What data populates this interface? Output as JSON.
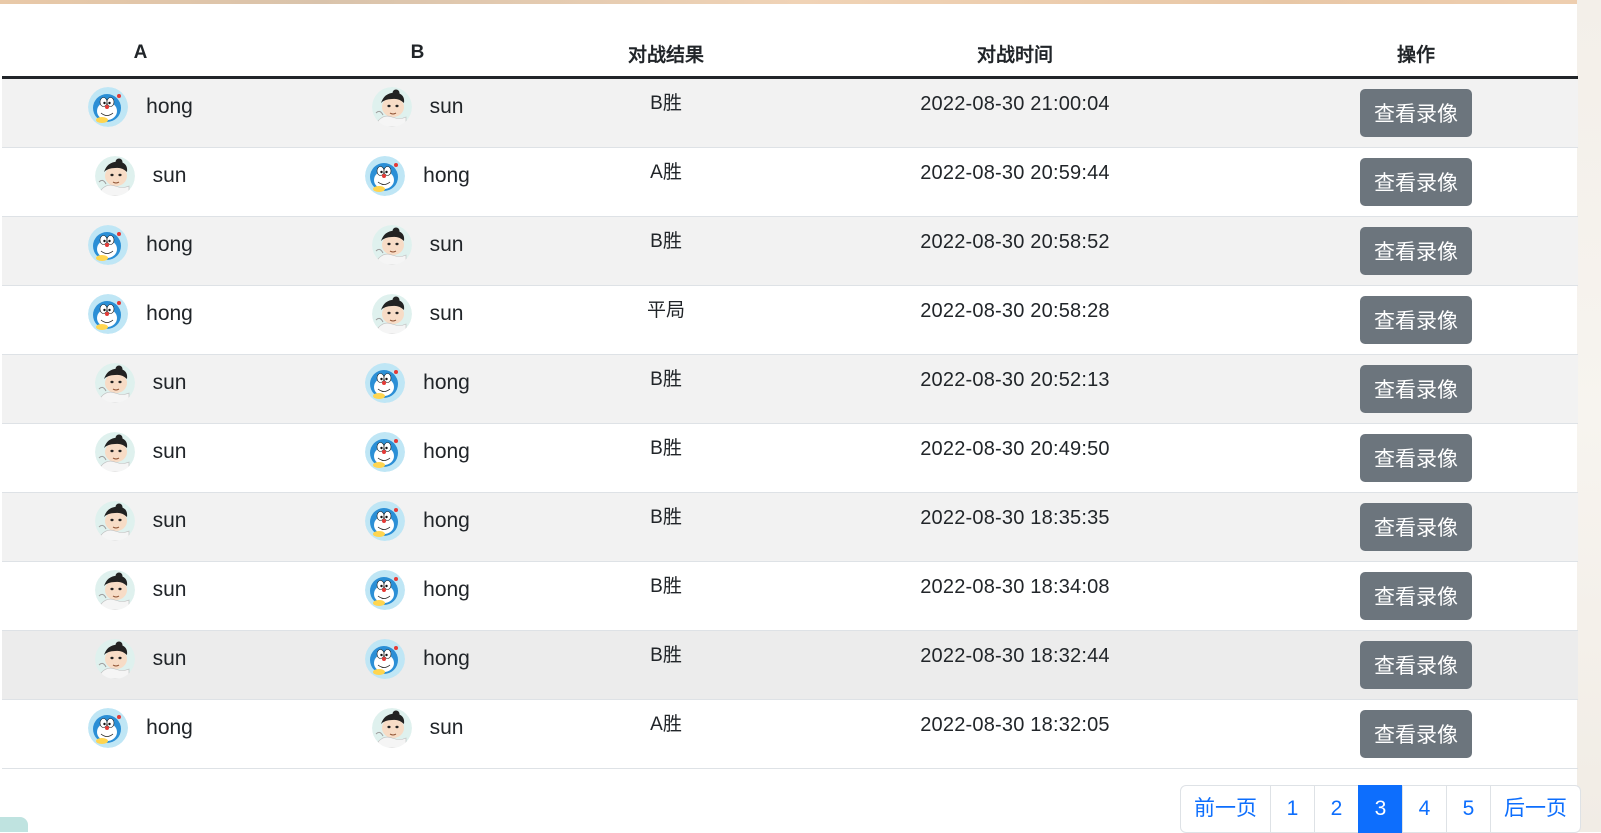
{
  "table": {
    "headers": {
      "a": "A",
      "b": "B",
      "result": "对战结果",
      "time": "对战时间",
      "action": "操作"
    },
    "rows": [
      {
        "a": {
          "name": "hong",
          "avatar": "doraemon-avatar"
        },
        "b": {
          "name": "sun",
          "avatar": "boy-avatar"
        },
        "result": "B胜",
        "time": "2022-08-30 21:00:04",
        "action": "查看录像"
      },
      {
        "a": {
          "name": "sun",
          "avatar": "boy-avatar"
        },
        "b": {
          "name": "hong",
          "avatar": "doraemon-avatar"
        },
        "result": "A胜",
        "time": "2022-08-30 20:59:44",
        "action": "查看录像"
      },
      {
        "a": {
          "name": "hong",
          "avatar": "doraemon-avatar"
        },
        "b": {
          "name": "sun",
          "avatar": "boy-avatar"
        },
        "result": "B胜",
        "time": "2022-08-30 20:58:52",
        "action": "查看录像"
      },
      {
        "a": {
          "name": "hong",
          "avatar": "doraemon-avatar"
        },
        "b": {
          "name": "sun",
          "avatar": "boy-avatar"
        },
        "result": "平局",
        "time": "2022-08-30 20:58:28",
        "action": "查看录像"
      },
      {
        "a": {
          "name": "sun",
          "avatar": "boy-avatar"
        },
        "b": {
          "name": "hong",
          "avatar": "doraemon-avatar"
        },
        "result": "B胜",
        "time": "2022-08-30 20:52:13",
        "action": "查看录像"
      },
      {
        "a": {
          "name": "sun",
          "avatar": "boy-avatar"
        },
        "b": {
          "name": "hong",
          "avatar": "doraemon-avatar"
        },
        "result": "B胜",
        "time": "2022-08-30 20:49:50",
        "action": "查看录像"
      },
      {
        "a": {
          "name": "sun",
          "avatar": "boy-avatar"
        },
        "b": {
          "name": "hong",
          "avatar": "doraemon-avatar"
        },
        "result": "B胜",
        "time": "2022-08-30 18:35:35",
        "action": "查看录像"
      },
      {
        "a": {
          "name": "sun",
          "avatar": "boy-avatar"
        },
        "b": {
          "name": "hong",
          "avatar": "doraemon-avatar"
        },
        "result": "B胜",
        "time": "2022-08-30 18:34:08",
        "action": "查看录像"
      },
      {
        "a": {
          "name": "sun",
          "avatar": "boy-avatar"
        },
        "b": {
          "name": "hong",
          "avatar": "doraemon-avatar"
        },
        "result": "B胜",
        "time": "2022-08-30 18:32:44",
        "action": "查看录像"
      },
      {
        "a": {
          "name": "hong",
          "avatar": "doraemon-avatar"
        },
        "b": {
          "name": "sun",
          "avatar": "boy-avatar"
        },
        "result": "A胜",
        "time": "2022-08-30 18:32:05",
        "action": "查看录像"
      }
    ]
  },
  "pagination": {
    "prev": "前一页",
    "pages": [
      "1",
      "2",
      "3",
      "4",
      "5"
    ],
    "current": "3",
    "next": "后一页"
  },
  "colors": {
    "button_bg": "#6c757d",
    "pagination_active": "#0d6efd",
    "link": "#0d6efd",
    "striped_row": "#f2f2f2",
    "header_border": "#212529"
  }
}
